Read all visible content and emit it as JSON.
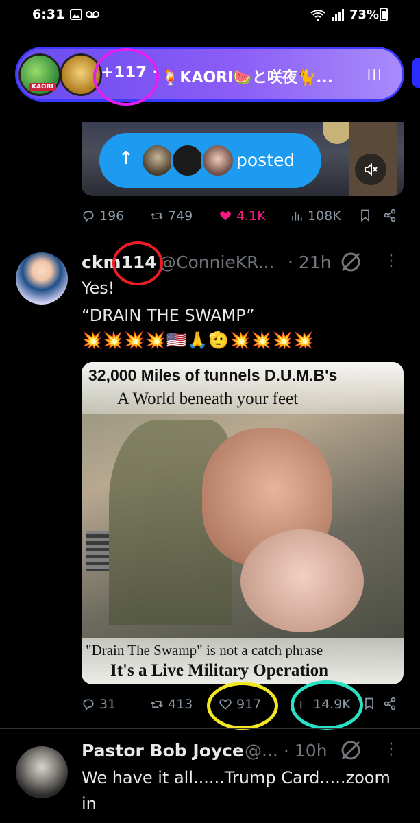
{
  "status_bar": {
    "time": "6:31",
    "battery": "73%"
  },
  "spaces": {
    "host_badge": "KAORI",
    "listener_count": "+117 ·",
    "title": "🍹KAORI🍉と咲夜🐈...",
    "menu_icon": "|||"
  },
  "colors": {
    "accent": "#1d9bf0",
    "like": "#f91880",
    "spaces_gradient_start": "#6a4cf0",
    "annotation_magenta": "#e41ef0",
    "annotation_red": "#ee1c24",
    "annotation_yellow": "#f3e625",
    "annotation_cyan": "#2be0c4"
  },
  "posted_pill": {
    "label": "posted"
  },
  "prev_tweet_actions": {
    "replies": "196",
    "retweets": "749",
    "likes": "4.1K",
    "views": "108K",
    "liked": true
  },
  "tweet": {
    "display_name": "ckm114",
    "handle": "@ConnieKR...",
    "time": "· 21h",
    "text_line1": "Yes!",
    "text_line2": "“DRAIN THE SWAMP”",
    "emojis": "💥💥💥💥🇺🇸🙏🫡💥💥💥💥",
    "media": {
      "title_line1": "32,000 Miles of tunnels D.U.M.B's",
      "title_line2": "A World beneath your feet",
      "caption_line1": "\"Drain The Swamp\" is not a catch phrase",
      "caption_line2": "It's a Live Military Operation"
    },
    "actions": {
      "replies": "31",
      "retweets": "413",
      "likes": "917",
      "views": "14.9K"
    }
  },
  "next_tweet": {
    "display_name": "Pastor Bob Joyce",
    "handle": "@...",
    "time": "· 10h",
    "text_line1": "We have it all......Trump Card.....zoom",
    "text_line2": "in"
  },
  "icons": [
    "reply-icon",
    "retweet-icon",
    "heart-icon",
    "views-icon",
    "bookmark-icon",
    "share-icon",
    "grok-icon",
    "more-icon",
    "mute-icon",
    "arrow-up-icon",
    "wifi-icon",
    "signal-icon",
    "gallery-icon",
    "voicemail-icon"
  ]
}
